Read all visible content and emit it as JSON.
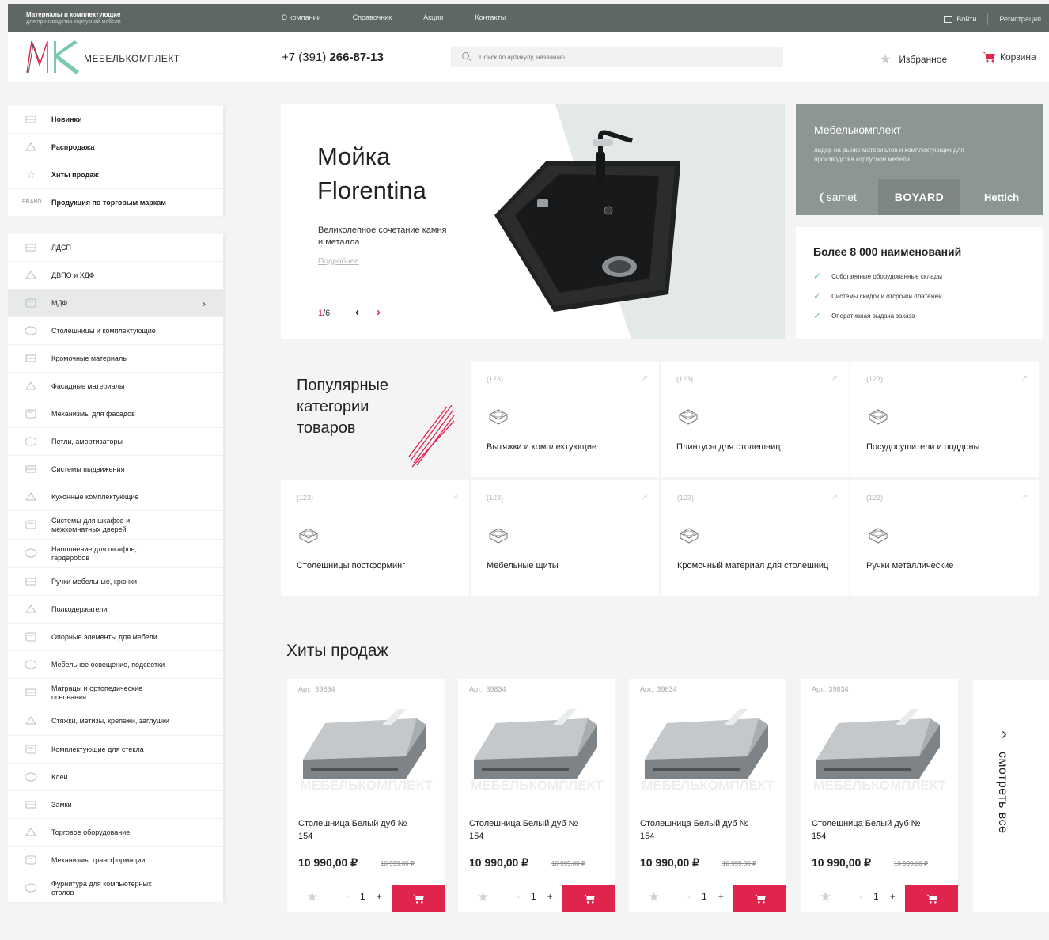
{
  "topbar": {
    "brand_line1": "Материалы и комплектующие",
    "brand_line2": "для производства корпусной мебели",
    "nav": [
      "О компании",
      "Справочник",
      "Акции",
      "Контакты"
    ],
    "login": "Войти",
    "register": "Регистрация"
  },
  "header": {
    "logo_text": "МЕБЕЛЬКОМПЛЕКТ",
    "phone_prefix": "+7 (391) ",
    "phone_main": "266-87-13",
    "search_placeholder": "Поиск по артикулу, названию",
    "favorites": "Избранное",
    "cart": "Корзина"
  },
  "sidebar": {
    "top": [
      {
        "label": "Новинки",
        "icon": "new-badge-icon"
      },
      {
        "label": "Распродажа",
        "icon": "sale-tag-icon"
      },
      {
        "label": "Хиты продаж",
        "icon": "star-icon"
      },
      {
        "label": "Продукция по торговым маркам",
        "icon": "brand-icon",
        "icon_text": "BRAND"
      }
    ],
    "items": [
      {
        "label": "ЛДСП",
        "icon": "board-icon"
      },
      {
        "label": "ДВПО и ХДФ",
        "icon": "sheet-icon"
      },
      {
        "label": "МДФ",
        "icon": "mdf-icon",
        "active": true
      },
      {
        "label": "Столешницы и комплектующие",
        "icon": "countertop-icon"
      },
      {
        "label": "Кромочные материалы",
        "icon": "edge-icon"
      },
      {
        "label": "Фасадные материалы",
        "icon": "facade-icon"
      },
      {
        "label": "Механизмы для фасадов",
        "icon": "mechanism-icon"
      },
      {
        "label": "Петли, амортизаторы",
        "icon": "hinge-icon"
      },
      {
        "label": "Системы выдвижения",
        "icon": "drawer-icon"
      },
      {
        "label": "Кухонные комплектующие",
        "icon": "kitchen-icon"
      },
      {
        "label": "Системы для шкафов и межкомнатных дверей",
        "icon": "wardrobe-icon"
      },
      {
        "label": "Наполнение для шкафов, гардеробов",
        "icon": "hanger-icon"
      },
      {
        "label": "Ручки мебельные, крючки",
        "icon": "handle-icon"
      },
      {
        "label": "Полкодержатели",
        "icon": "shelf-holder-icon"
      },
      {
        "label": "Опорные элементы для мебели",
        "icon": "support-icon"
      },
      {
        "label": "Мебельное освещение, подсветки",
        "icon": "light-icon"
      },
      {
        "label": "Матрацы и ортопедические основания",
        "icon": "mattress-icon"
      },
      {
        "label": "Стяжки, метизы, крепежи, заглушки",
        "icon": "fastener-icon"
      },
      {
        "label": "Комплектующие для стекла",
        "icon": "glass-icon"
      },
      {
        "label": "Клеи",
        "icon": "glue-icon"
      },
      {
        "label": "Замки",
        "icon": "lock-icon"
      },
      {
        "label": "Торговое оборудование",
        "icon": "trade-icon"
      },
      {
        "label": "Механизмы трансформации",
        "icon": "transform-icon"
      },
      {
        "label": "Фурнитура для компьютерных столов",
        "icon": "computer-desk-icon"
      }
    ]
  },
  "hero": {
    "title": "Мойка Florentina",
    "subtitle": "Великолепное сочетание камня и металла",
    "more": "Подробнее",
    "page_current": "1",
    "page_total": "/6"
  },
  "promo": {
    "title": "Мебелькомплект —",
    "text": "лидер на рынке материалов и комплектующих для производства корпусной мебели.",
    "brands": [
      "samet",
      "BOYARD",
      "Hettich"
    ]
  },
  "info": {
    "title": "Более 8 000 наименований",
    "points": [
      "Собственные оборудованные склады",
      "Системы скидок и отсрочки платежей",
      "Оперативная выдача заказа"
    ]
  },
  "popular": {
    "title": "Популярные категории товаров",
    "categories": [
      {
        "count": "(123)",
        "name": "Вытяжки и комплектующие"
      },
      {
        "count": "(123)",
        "name": "Плинтусы для столешниц"
      },
      {
        "count": "(123)",
        "name": "Посудосушители и поддоны"
      },
      {
        "count": "(123)",
        "name": "Столешницы постформинг"
      },
      {
        "count": "(123)",
        "name": "Мебельные щиты"
      },
      {
        "count": "(123)",
        "name": "Кромочный материал для столешниц"
      },
      {
        "count": "(123)",
        "name": "Ручки металлические"
      }
    ]
  },
  "hits": {
    "title": "Хиты продаж",
    "see_all": "смотреть все",
    "products": [
      {
        "art": "Арт.: 39834",
        "name": "Столешница Белый дуб № 154",
        "price": "10 990,00 ₽",
        "old": "10 999,00 ₽",
        "qty": "1"
      },
      {
        "art": "Арт.: 39834",
        "name": "Столешница Белый дуб № 154",
        "price": "10 990,00 ₽",
        "old": "10 999,00 ₽",
        "qty": "1"
      },
      {
        "art": "Арт.: 39834",
        "name": "Столешница Белый дуб № 154",
        "price": "10 990,00 ₽",
        "old": "10 999,00 ₽",
        "qty": "1"
      },
      {
        "art": "Арт.: 39834",
        "name": "Столешница Белый дуб № 154",
        "price": "10 990,00 ₽",
        "old": "10 999,00 ₽",
        "qty": "1"
      }
    ],
    "watermark": "МЕБЕЛЬКОМПЛЕКТ"
  },
  "colors": {
    "accent": "#e0244e",
    "topbar": "#5e6763",
    "promo": "#8d9791",
    "check": "#6fc0a7"
  }
}
